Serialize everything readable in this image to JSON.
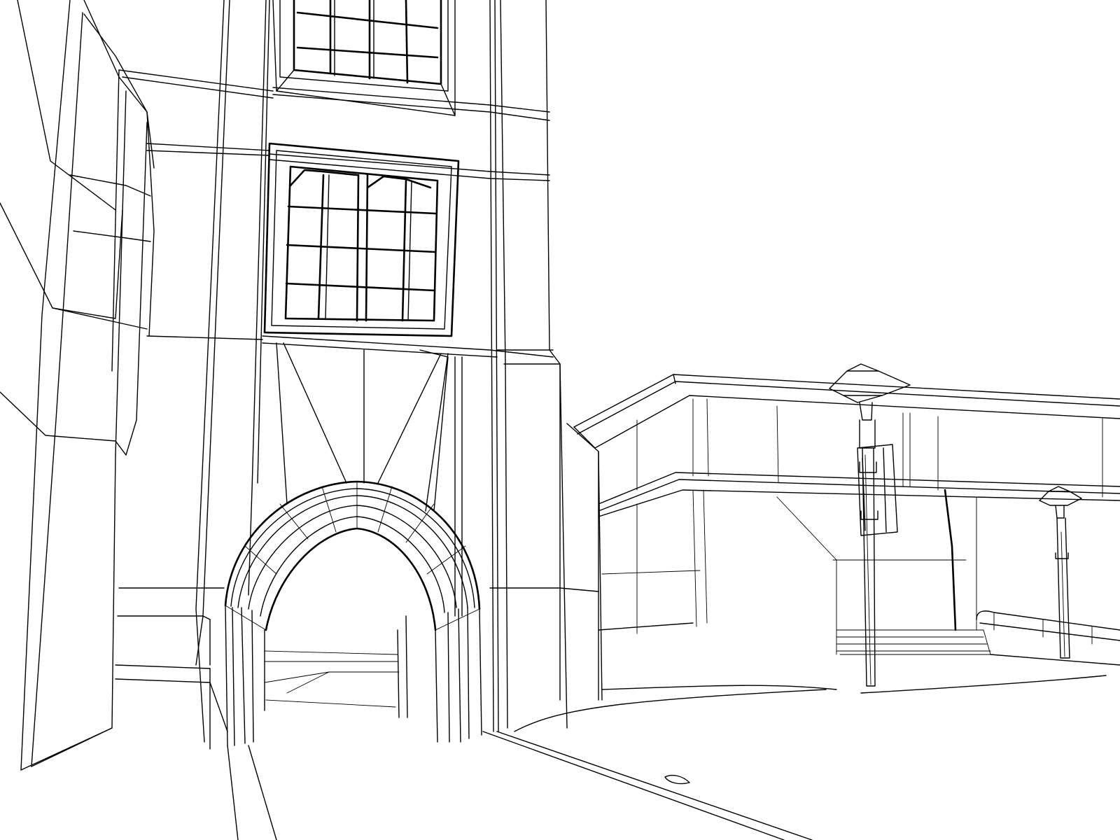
{
  "scene": {
    "kind": "line-art",
    "background": "#ffffff",
    "ink": "#000000"
  }
}
